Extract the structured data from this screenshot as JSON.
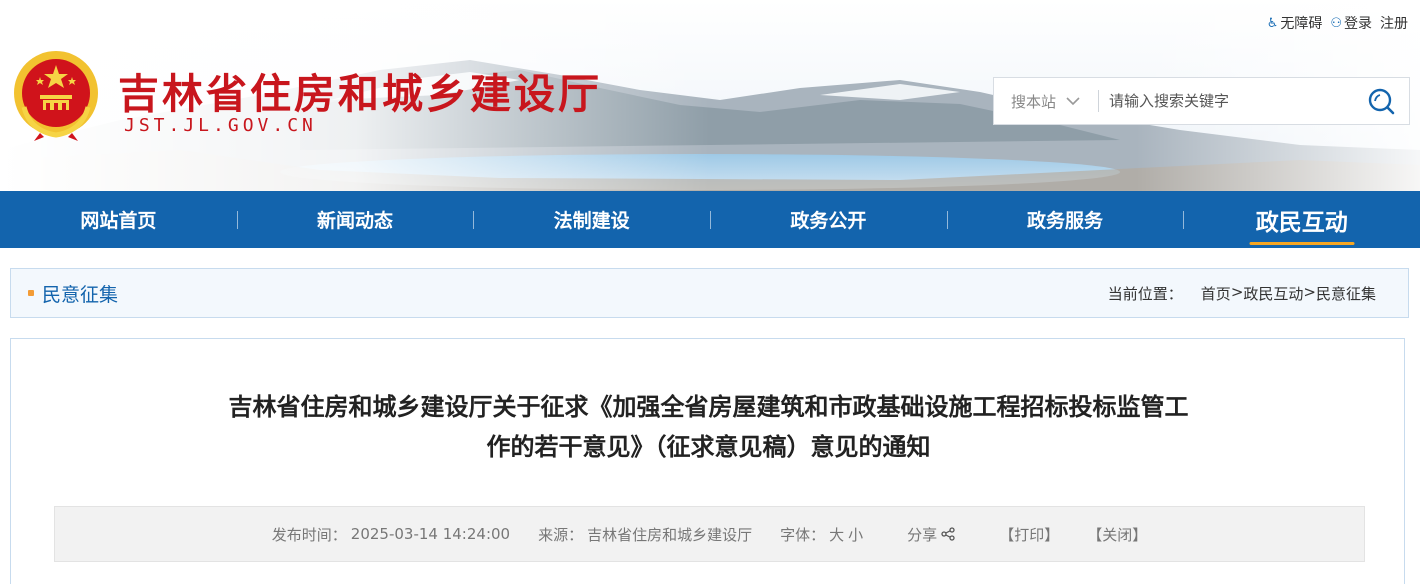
{
  "top_links": {
    "accessibility": "无障碍",
    "login": "登录",
    "register": "注册"
  },
  "site": {
    "title": "吉林省住房和城乡建设厅",
    "domain": "JST.JL.GOV.CN"
  },
  "search": {
    "scope": "搜本站",
    "placeholder": "请输入搜索关键字"
  },
  "nav": {
    "items": [
      {
        "label": "网站首页"
      },
      {
        "label": "新闻动态"
      },
      {
        "label": "法制建设"
      },
      {
        "label": "政务公开"
      },
      {
        "label": "政务服务"
      },
      {
        "label": "政民互动"
      }
    ],
    "active_index": 5
  },
  "breadcrumb": {
    "section_title": "民意征集",
    "location_label": "当前位置：",
    "path": [
      "首页",
      "政民互动",
      "民意征集"
    ],
    "separator": ">"
  },
  "article": {
    "title_line1": "吉林省住房和城乡建设厅关于征求《加强全省房屋建筑和市政基础设施工程招标投标监管工",
    "title_line2": "作的若干意见》（征求意见稿）意见的通知",
    "publish_label": "发布时间：",
    "publish_time": "2025-03-14 14:24:00",
    "source_label": "来源：",
    "source": "吉林省住房和城乡建设厅",
    "font_label": "字体：",
    "font_large": "大",
    "font_small": "小",
    "share": "分享",
    "print": "【打印】",
    "close": "【关闭】"
  },
  "colors": {
    "brand_red": "#c8161d",
    "nav_blue": "#1364ad",
    "accent_orange": "#f39c36"
  }
}
